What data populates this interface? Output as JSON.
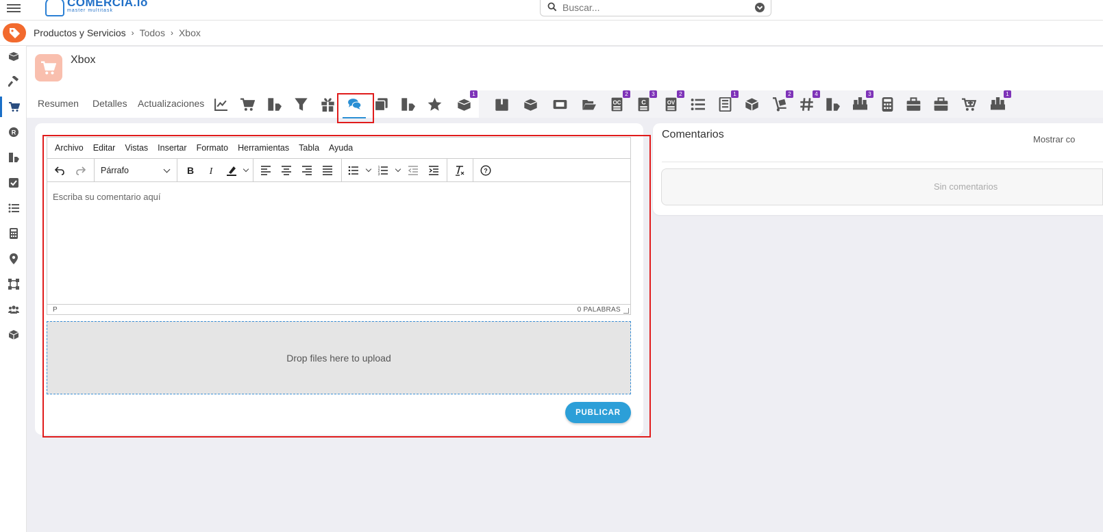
{
  "app": {
    "logo_text": "COMERCIA.io",
    "logo_tagline": "master multitask",
    "search_placeholder": "Buscar..."
  },
  "breadcrumb": {
    "items": [
      "Productos y Servicios",
      "Todos",
      "Xbox"
    ]
  },
  "sidebar": {
    "items": [
      {
        "icon": "box-open-icon"
      },
      {
        "icon": "hammer-icon"
      },
      {
        "icon": "cart-icon",
        "active": true
      },
      {
        "icon": "registered-icon"
      },
      {
        "icon": "book-tag-icon"
      },
      {
        "icon": "checkbox-icon"
      },
      {
        "icon": "list-icon"
      },
      {
        "icon": "calculator-icon"
      },
      {
        "icon": "map-pin-icon"
      },
      {
        "icon": "vector-square-icon"
      },
      {
        "icon": "users-icon"
      },
      {
        "icon": "cube-icon"
      }
    ]
  },
  "product": {
    "title": "Xbox",
    "icon": "cart-icon"
  },
  "tabs": {
    "text_tabs": [
      "Resumen",
      "Detalles",
      "Actualizaciones"
    ],
    "icon_tabs": [
      {
        "icon": "chart-line-icon",
        "badge": ""
      },
      {
        "icon": "cart-icon",
        "badge": ""
      },
      {
        "icon": "book-tag-icon",
        "badge": ""
      },
      {
        "icon": "filter-icon",
        "badge": ""
      },
      {
        "icon": "gift-icon",
        "badge": ""
      },
      {
        "icon": "comments-icon",
        "badge": "",
        "active": true
      },
      {
        "icon": "clone-icon",
        "badge": ""
      },
      {
        "icon": "book-tag-icon",
        "badge": ""
      },
      {
        "icon": "star-icon",
        "badge": ""
      },
      {
        "icon": "box-open-icon",
        "badge": "1"
      },
      {
        "icon": "box-icon",
        "badge": ""
      },
      {
        "icon": "box-open-icon",
        "badge": ""
      },
      {
        "icon": "ticket-icon",
        "badge": ""
      },
      {
        "icon": "folder-open-icon",
        "badge": ""
      },
      {
        "icon": "oc-doc-icon",
        "badge": "2"
      },
      {
        "icon": "c-doc-icon",
        "badge": "3"
      },
      {
        "icon": "ov-doc-icon",
        "badge": "2"
      },
      {
        "icon": "list-icon",
        "badge": ""
      },
      {
        "icon": "calculator-doc-icon",
        "badge": "1"
      },
      {
        "icon": "cube-icon",
        "badge": ""
      },
      {
        "icon": "dolly-icon",
        "badge": "2"
      },
      {
        "icon": "hashtag-icon",
        "badge": "4"
      },
      {
        "icon": "book-tag-icon",
        "badge": ""
      },
      {
        "icon": "pallet-icon",
        "badge": "3"
      },
      {
        "icon": "calculator-icon",
        "badge": ""
      },
      {
        "icon": "briefcase-icon",
        "badge": ""
      },
      {
        "icon": "briefcase-icon",
        "badge": ""
      },
      {
        "icon": "cart-plus-icon",
        "badge": ""
      },
      {
        "icon": "pallet-icon",
        "badge": "1"
      }
    ]
  },
  "editor": {
    "menu": [
      "Archivo",
      "Editar",
      "Vistas",
      "Insertar",
      "Formato",
      "Herramientas",
      "Tabla",
      "Ayuda"
    ],
    "block_format": "Párrafo",
    "placeholder": "Escriba su comentario aquí",
    "status_path": "P",
    "word_count": "0 PALABRAS"
  },
  "upload": {
    "dropzone_text": "Drop files here to upload"
  },
  "publish_label": "PUBLICAR",
  "comments": {
    "title": "Comentarios",
    "show_link": "Mostrar co",
    "empty_text": "Sin comentarios"
  },
  "colors": {
    "accent": "#2c9fd8",
    "brand_orange": "#f26a2e",
    "badge": "#7e33b8",
    "highlight": "#e01b1b"
  }
}
